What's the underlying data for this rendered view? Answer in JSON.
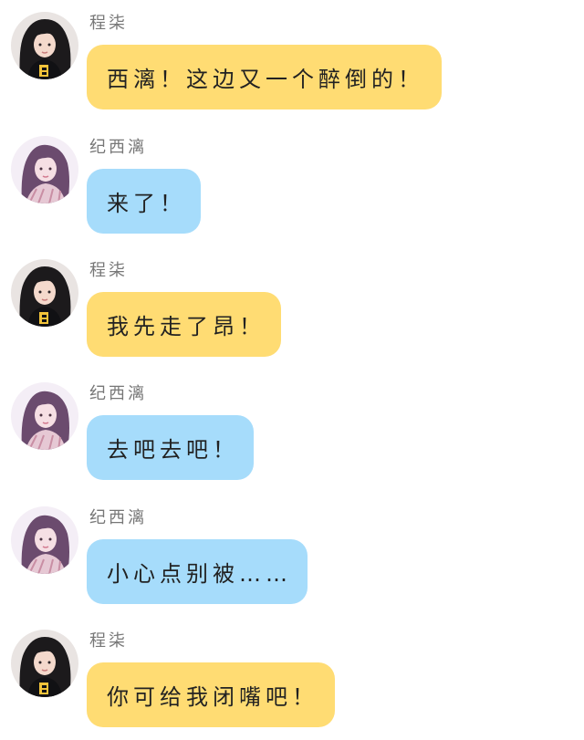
{
  "colors": {
    "yellow_bubble": "#ffdc73",
    "blue_bubble": "#a6dcfb",
    "name_text": "#777777",
    "message_text": "#222222"
  },
  "messages": [
    {
      "sender": "程柒",
      "avatar": "avatar-dark-hair-girl",
      "bubble": "yellow",
      "text": "西漓！这边又一个醉倒的！"
    },
    {
      "sender": "纪西漓",
      "avatar": "avatar-pink-filter-girl",
      "bubble": "blue",
      "text": "来了！"
    },
    {
      "sender": "程柒",
      "avatar": "avatar-dark-hair-girl",
      "bubble": "yellow",
      "text": "我先走了昂！"
    },
    {
      "sender": "纪西漓",
      "avatar": "avatar-pink-filter-girl",
      "bubble": "blue",
      "text": "去吧去吧！"
    },
    {
      "sender": "纪西漓",
      "avatar": "avatar-pink-filter-girl",
      "bubble": "blue",
      "text": "小心点别被……"
    },
    {
      "sender": "程柒",
      "avatar": "avatar-dark-hair-girl",
      "bubble": "yellow",
      "text": "你可给我闭嘴吧！"
    }
  ]
}
